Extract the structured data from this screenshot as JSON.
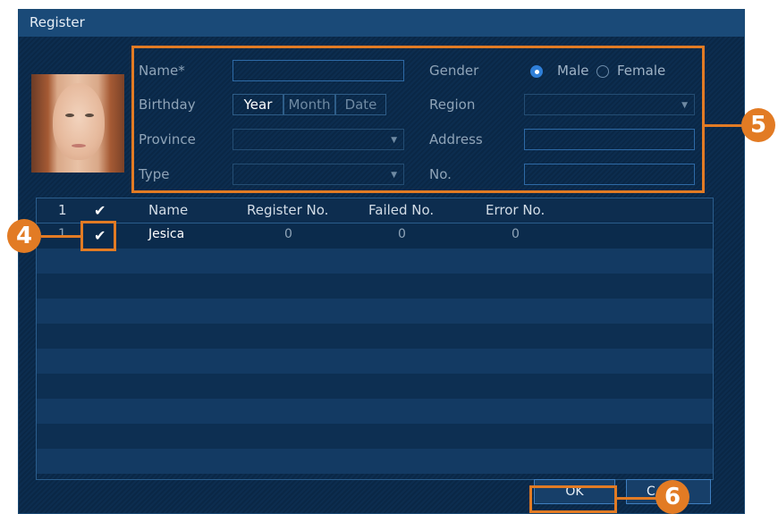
{
  "dialog": {
    "title": "Register"
  },
  "form": {
    "name_label": "Name*",
    "birthday_label": "Birthday",
    "province_label": "Province",
    "type_label": "Type",
    "gender_label": "Gender",
    "region_label": "Region",
    "address_label": "Address",
    "no_label": "No.",
    "birthday": {
      "year": "Year",
      "month": "Month",
      "date": "Date"
    },
    "gender_options": [
      "Male",
      "Female"
    ],
    "gender_selected": "Male",
    "name_value": "",
    "province_value": "",
    "type_value": "",
    "region_value": "",
    "address_value": "",
    "no_value": ""
  },
  "table": {
    "header": {
      "index": "1",
      "check": "✔",
      "name": "Name",
      "register_no": "Register No.",
      "failed_no": "Failed No.",
      "error_no": "Error No."
    },
    "rows": [
      {
        "index": "1",
        "check": "✔",
        "name": "Jesica",
        "register_no": "0",
        "failed_no": "0",
        "error_no": "0"
      }
    ]
  },
  "buttons": {
    "ok": "OK",
    "cancel": "C"
  },
  "callouts": {
    "checkbox": "4",
    "form": "5",
    "ok": "6"
  },
  "colors": {
    "accent": "#e27b24",
    "panel": "#0c2d4f",
    "titlebar": "#1a4a78"
  }
}
